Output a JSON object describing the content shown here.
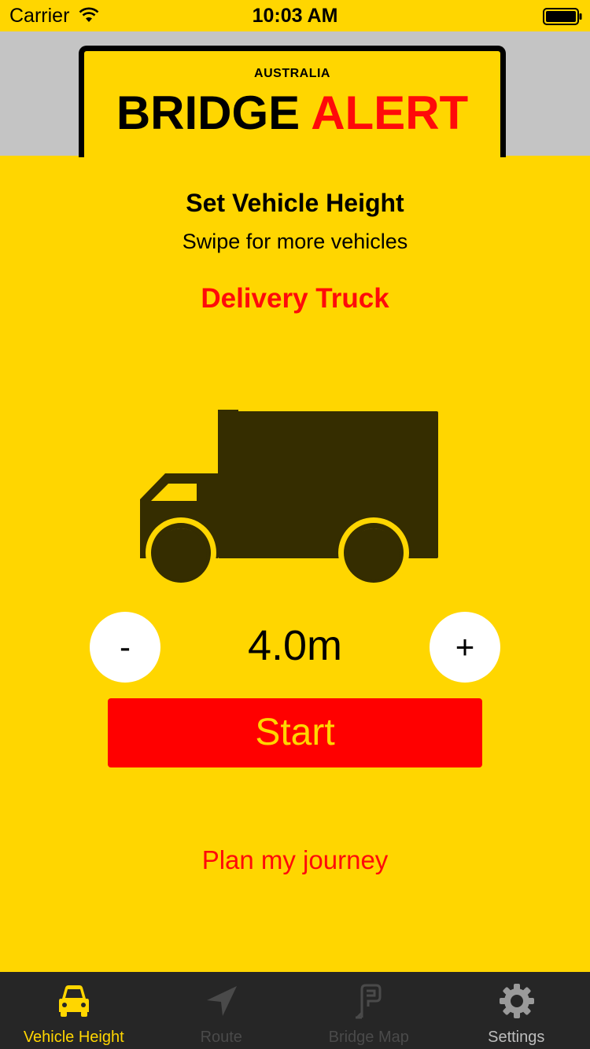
{
  "status_bar": {
    "carrier": "Carrier",
    "time": "10:03 AM"
  },
  "header": {
    "country": "AUSTRALIA",
    "title_word_1": "BRIDGE",
    "title_word_2": "ALERT"
  },
  "main": {
    "title": "Set Vehicle Height",
    "subtitle": "Swipe for more vehicles",
    "vehicle_name": "Delivery Truck",
    "height_value": "4.0m",
    "decrement_label": "-",
    "increment_label": "+",
    "start_label": "Start",
    "plan_link": "Plan my journey"
  },
  "tab_bar": {
    "tabs": [
      {
        "label": "Vehicle Height",
        "icon": "car-icon",
        "active": true
      },
      {
        "label": "Route",
        "icon": "navigation-arrow-icon",
        "active": false
      },
      {
        "label": "Bridge Map",
        "icon": "bridge-map-icon",
        "active": false
      },
      {
        "label": "Settings",
        "icon": "gear-icon",
        "active": false
      }
    ]
  },
  "colors": {
    "background": "#FFD600",
    "accent_red": "#FF0A0A",
    "truck": "#352D00",
    "tab_bar": "#262626",
    "tab_active": "#FFD600",
    "tab_disabled": "#4A4A4A",
    "tab_enabled": "#9A9A9A"
  }
}
